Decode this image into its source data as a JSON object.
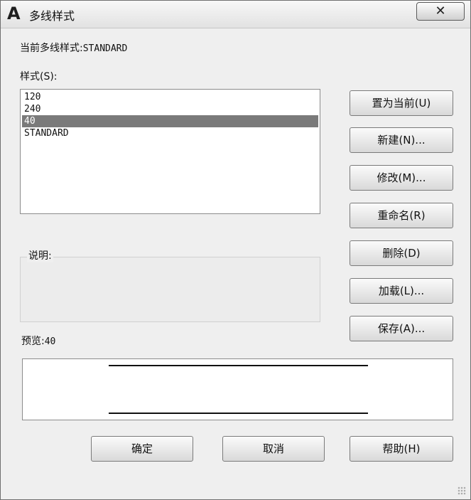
{
  "window": {
    "title": "多线样式",
    "app_icon_glyph": "A",
    "close_glyph": "✕"
  },
  "current_style": {
    "label": "当前多线样式:",
    "value": "STANDARD"
  },
  "styles": {
    "label": "样式(S):",
    "items": [
      "120",
      "240",
      "40",
      "STANDARD"
    ],
    "selected": "40"
  },
  "description": {
    "label": "说明:"
  },
  "preview": {
    "label": "预览:",
    "value": "40"
  },
  "side_buttons": {
    "set_current": "置为当前(U)",
    "new": "新建(N)...",
    "modify": "修改(M)...",
    "rename": "重命名(R)",
    "delete": "删除(D)",
    "load": "加载(L)...",
    "save": "保存(A)..."
  },
  "bottom_buttons": {
    "ok": "确定",
    "cancel": "取消",
    "help": "帮助(H)"
  }
}
